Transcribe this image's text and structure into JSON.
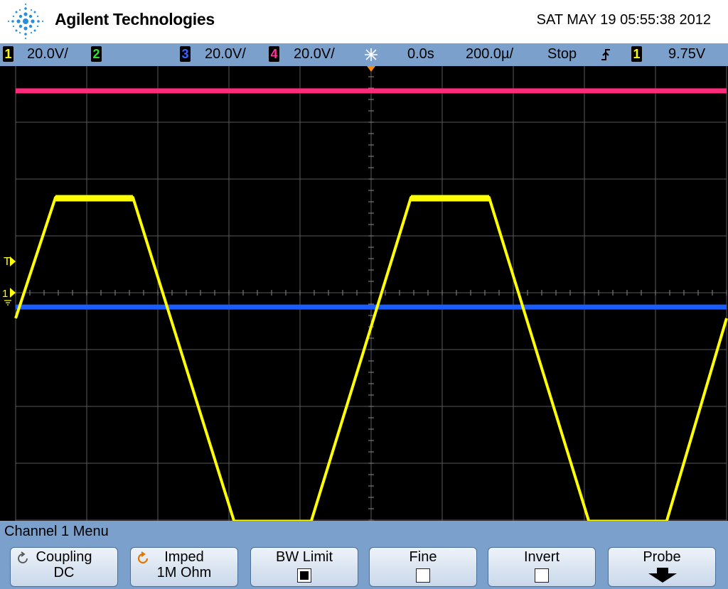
{
  "header": {
    "brand": "Agilent Technologies",
    "datetime": "SAT MAY 19 05:55:38 2012"
  },
  "status_bar": {
    "ch1": {
      "num": "1",
      "scale": "20.0V/",
      "color": "#ffff00"
    },
    "ch2": {
      "num": "2",
      "scale": "",
      "color": "#33dd33"
    },
    "ch3": {
      "num": "3",
      "scale": "20.0V/",
      "color": "#3366ff"
    },
    "ch4": {
      "num": "4",
      "scale": "20.0V/",
      "color": "#ff3399"
    },
    "delay": "0.0s",
    "timebase": "200.0µ/",
    "run_state": "Stop",
    "trigger_source": "1",
    "trigger_level": "9.75V",
    "trigger_icon": "trigger-position-icon",
    "edge_icon": "rising-edge-icon"
  },
  "screen": {
    "markers": {
      "trigger_level": "T",
      "ch1_ground": "1"
    },
    "traces": [
      {
        "name": "ch4-trace",
        "color": "#ff2a7a",
        "level": 0.888
      },
      {
        "name": "ch3-trace",
        "color": "#1a5cff",
        "level": -0.063
      },
      {
        "name": "ch1-trace",
        "color": "#ffff00"
      }
    ]
  },
  "menu": {
    "title": "Channel 1  Menu",
    "softkeys": [
      {
        "label": "Coupling",
        "value": "DC",
        "icon": "rotate-knob-icon"
      },
      {
        "label": "Imped",
        "value": "1M Ohm",
        "icon": "rotate-knob-icon"
      },
      {
        "label": "BW Limit",
        "checked": true
      },
      {
        "label": "Fine",
        "checked": false
      },
      {
        "label": "Invert",
        "checked": false
      },
      {
        "label": "Probe",
        "icon": "arrow-down-icon"
      }
    ]
  },
  "colors": {
    "accent_blue": "#7aa0cb",
    "screen_bg": "#000000",
    "grid": "#5a5a5a"
  }
}
